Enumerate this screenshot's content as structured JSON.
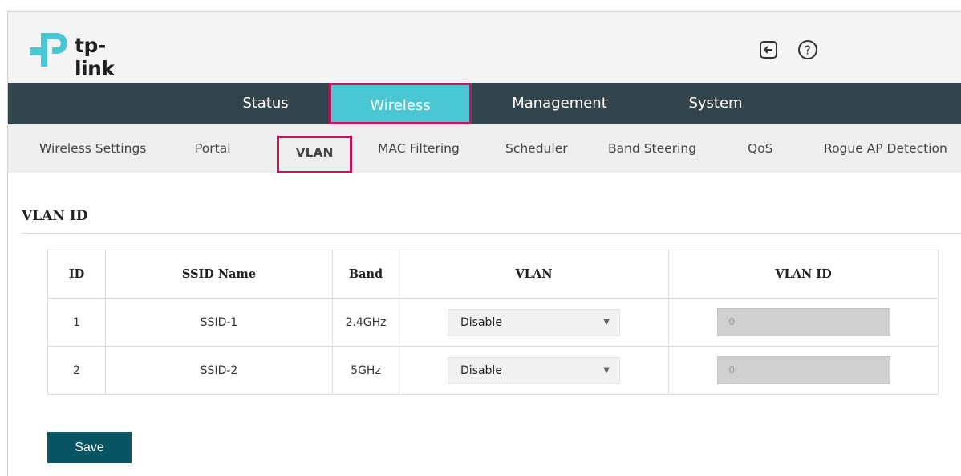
{
  "brand": {
    "name": "tp-link",
    "logo_color": "#4ac7d3"
  },
  "header": {
    "icons": [
      "logout-icon",
      "help-icon"
    ]
  },
  "main_nav": {
    "tabs": [
      {
        "label": "Status",
        "active": false
      },
      {
        "label": "Wireless",
        "active": true
      },
      {
        "label": "Management",
        "active": false
      },
      {
        "label": "System",
        "active": false
      }
    ],
    "bg_color": "#34444c",
    "active_color": "#4ac7d3",
    "highlight_color": "#c2185b"
  },
  "sub_nav": {
    "items": [
      {
        "label": "Wireless Settings",
        "active": false
      },
      {
        "label": "Portal",
        "active": false
      },
      {
        "label": "VLAN",
        "active": true
      },
      {
        "label": "MAC Filtering",
        "active": false
      },
      {
        "label": "Scheduler",
        "active": false
      },
      {
        "label": "Band Steering",
        "active": false
      },
      {
        "label": "QoS",
        "active": false
      },
      {
        "label": "Rogue AP Detection",
        "active": false
      }
    ]
  },
  "section": {
    "title": "VLAN ID"
  },
  "table": {
    "headers": [
      "ID",
      "SSID Name",
      "Band",
      "VLAN",
      "VLAN ID"
    ],
    "rows": [
      {
        "id": "1",
        "ssid": "SSID-1",
        "band": "2.4GHz",
        "vlan": "Disable",
        "vlan_id": "0"
      },
      {
        "id": "2",
        "ssid": "SSID-2",
        "band": "5GHz",
        "vlan": "Disable",
        "vlan_id": "0"
      }
    ]
  },
  "save_button": {
    "label": "Save",
    "color": "#075563"
  }
}
